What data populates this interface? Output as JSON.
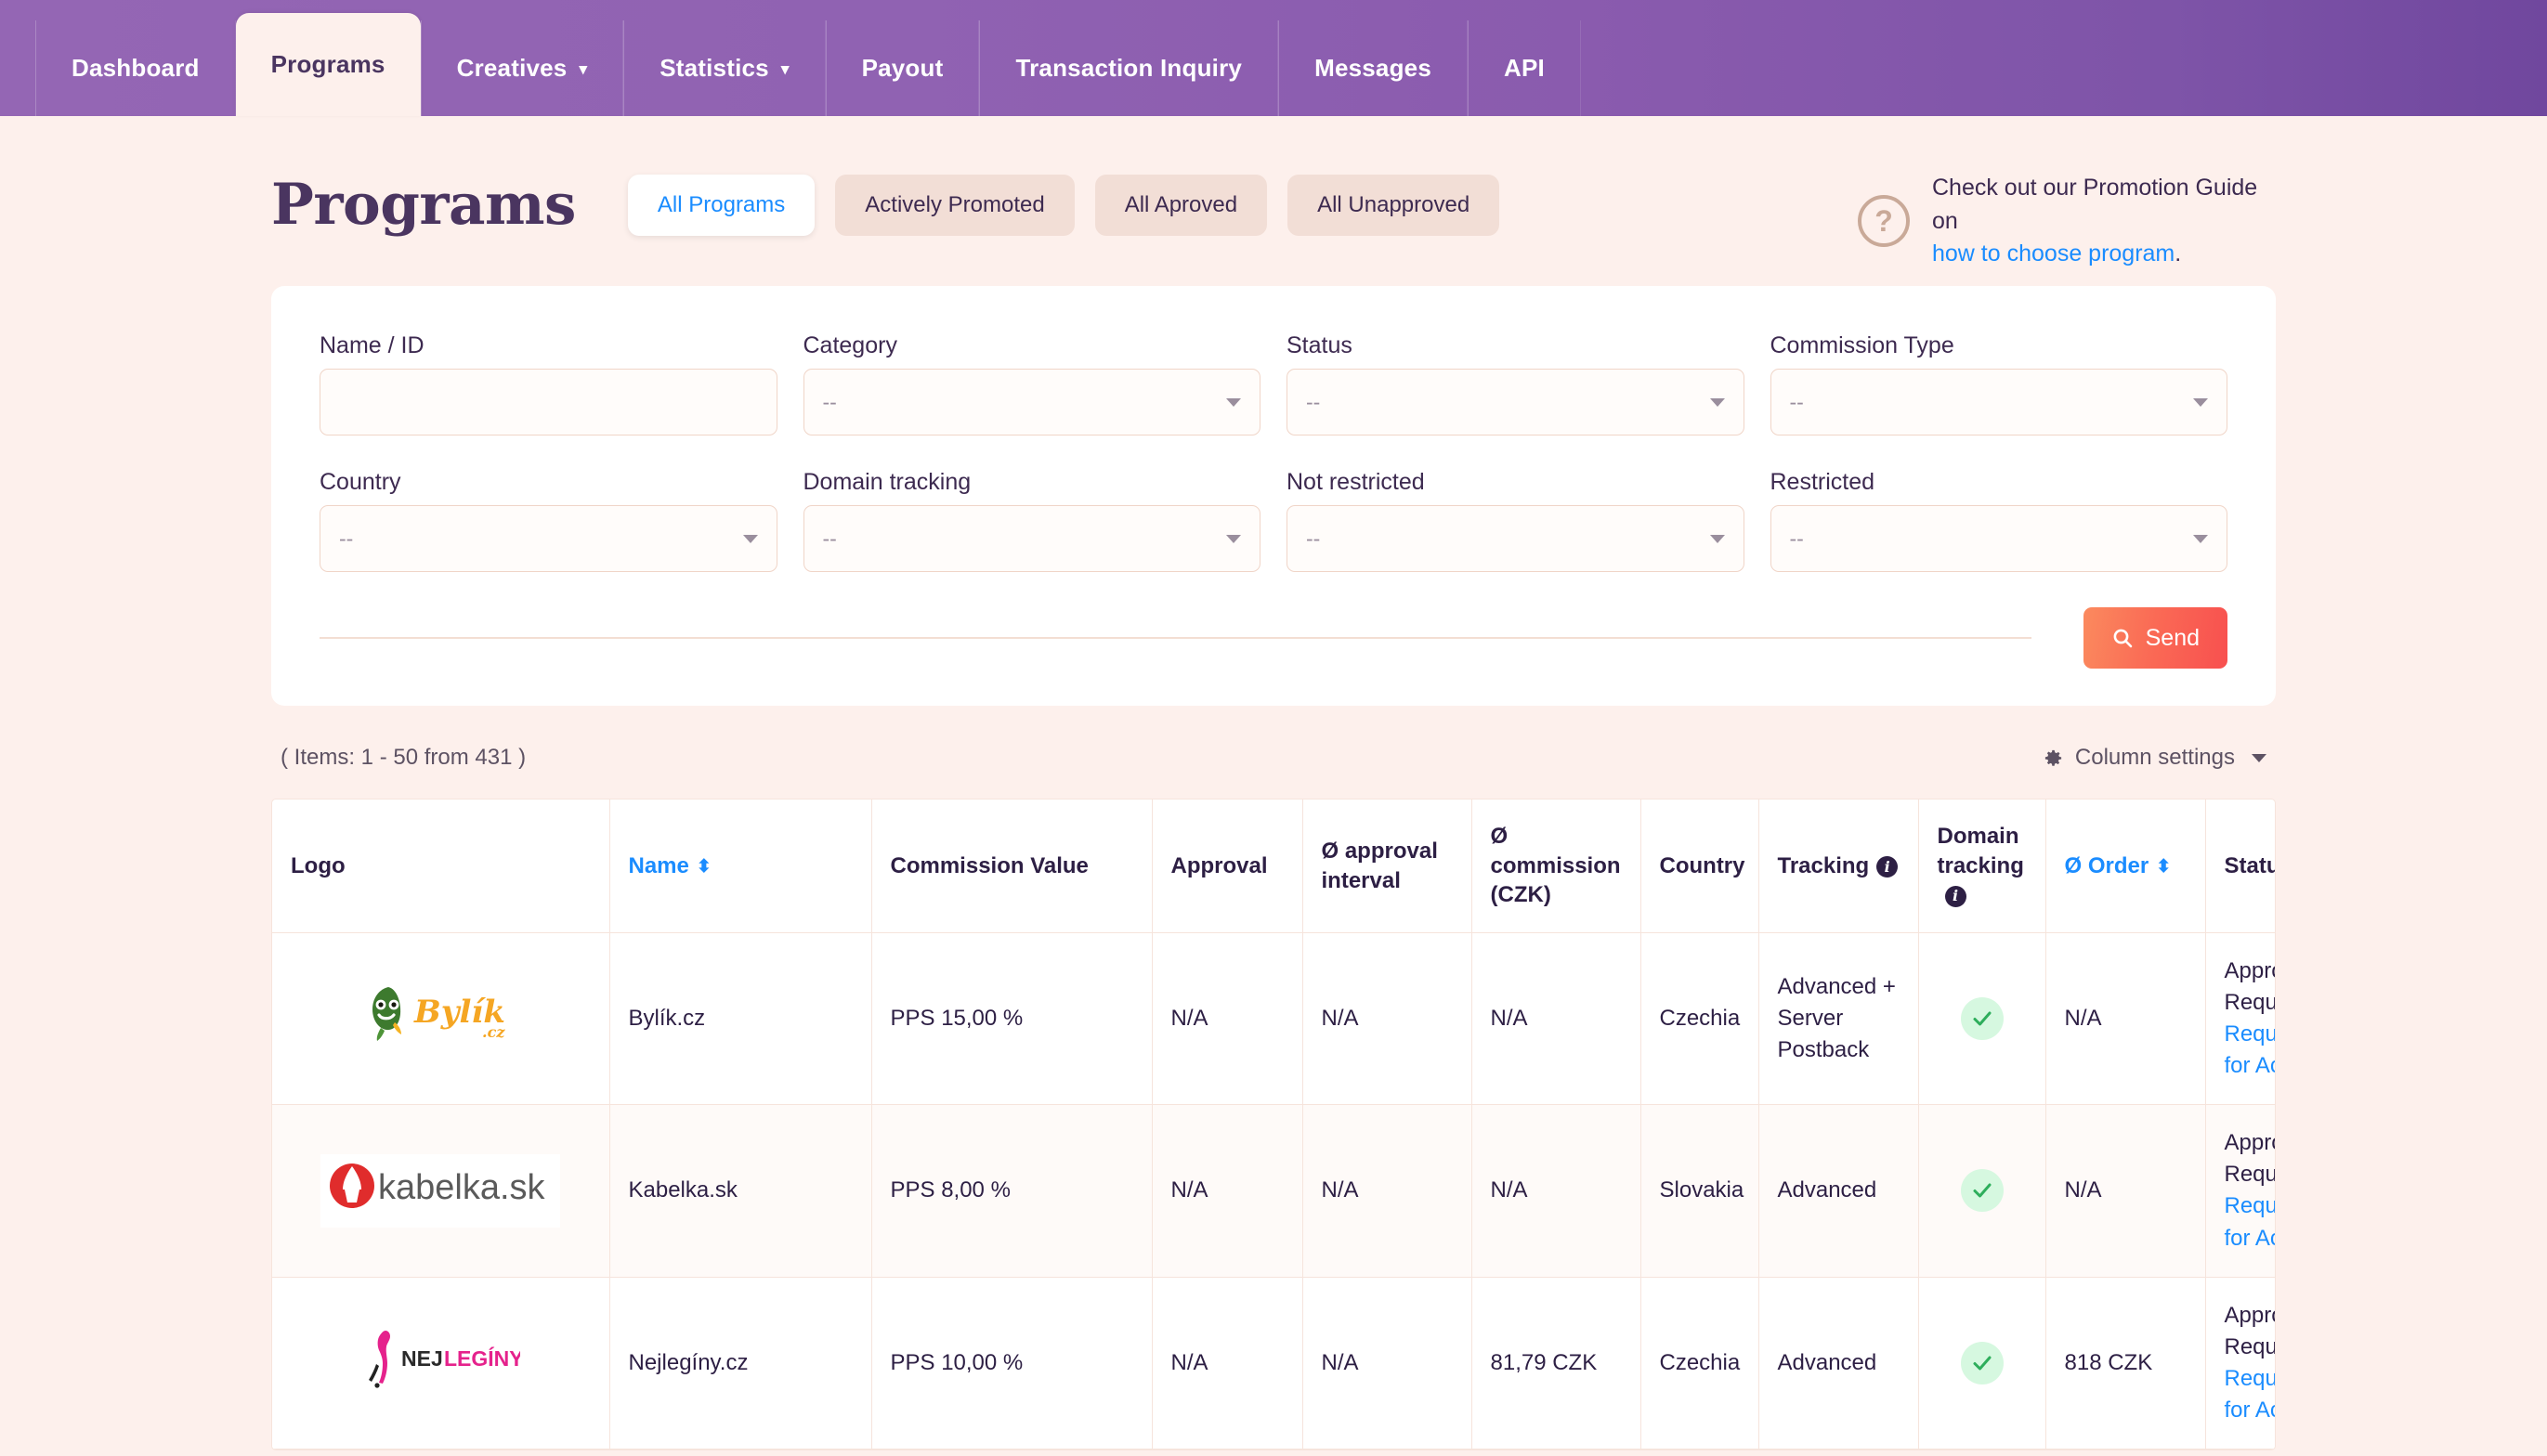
{
  "nav": {
    "items": [
      {
        "label": "Dashboard",
        "caret": false,
        "active": false
      },
      {
        "label": "Programs",
        "caret": false,
        "active": true
      },
      {
        "label": "Creatives",
        "caret": true,
        "active": false
      },
      {
        "label": "Statistics",
        "caret": true,
        "active": false
      },
      {
        "label": "Payout",
        "caret": false,
        "active": false
      },
      {
        "label": "Transaction Inquiry",
        "caret": false,
        "active": false
      },
      {
        "label": "Messages",
        "caret": false,
        "active": false
      },
      {
        "label": "API",
        "caret": false,
        "active": false
      }
    ],
    "caret_glyph": "▾"
  },
  "header": {
    "title": "Programs",
    "segments": [
      {
        "label": "All Programs",
        "active": true
      },
      {
        "label": "Actively Promoted",
        "active": false
      },
      {
        "label": "All Aproved",
        "active": false
      },
      {
        "label": "All Unapproved",
        "active": false
      }
    ],
    "promo": {
      "icon": "question-mark-circle-icon",
      "question_glyph": "?",
      "line1": "Check out our Promotion Guide on",
      "link": "how to choose program",
      "period": "."
    }
  },
  "filters": {
    "fields": [
      {
        "label": "Name / ID",
        "type": "text",
        "value": "",
        "placeholder": ""
      },
      {
        "label": "Category",
        "type": "select",
        "value": "--"
      },
      {
        "label": "Status",
        "type": "select",
        "value": "--"
      },
      {
        "label": "Commission Type",
        "type": "select",
        "value": "--"
      },
      {
        "label": "Country",
        "type": "select",
        "value": "--"
      },
      {
        "label": "Domain tracking",
        "type": "select",
        "value": "--"
      },
      {
        "label": "Not restricted",
        "type": "select",
        "value": "--"
      },
      {
        "label": "Restricted",
        "type": "select",
        "value": "--"
      }
    ],
    "send_label": "Send",
    "send_icon": "magnifier-icon"
  },
  "meta": {
    "items_count": "( Items: 1 - 50 from 431 )",
    "column_settings": "Column settings",
    "gear_icon": "gear-icon",
    "caret_icon": "chevron-down-icon"
  },
  "table": {
    "columns": [
      {
        "key": "logo",
        "label": "Logo",
        "sortable": false,
        "info": false
      },
      {
        "key": "name",
        "label": "Name",
        "sortable": true,
        "info": false
      },
      {
        "key": "commission",
        "label": "Commission Value",
        "sortable": false,
        "info": false
      },
      {
        "key": "approval",
        "label": "Approval",
        "sortable": false,
        "info": false
      },
      {
        "key": "interval",
        "label": "Ø approval interval",
        "sortable": false,
        "info": false
      },
      {
        "key": "avgcomm",
        "label": "Ø commission (CZK)",
        "sortable": false,
        "info": false
      },
      {
        "key": "country",
        "label": "Country",
        "sortable": false,
        "info": false
      },
      {
        "key": "tracking",
        "label": "Tracking",
        "sortable": false,
        "info": true
      },
      {
        "key": "domain",
        "label": "Domain tracking",
        "sortable": false,
        "info": true
      },
      {
        "key": "order",
        "label": "Ø Order",
        "sortable": true,
        "info": false
      },
      {
        "key": "status",
        "label": "Status",
        "sortable": false,
        "info": false
      }
    ],
    "sort_glyph": "⬍",
    "info_glyph": "i",
    "rows": [
      {
        "logo_alt": "Bylík.cz logo",
        "logo_type": "bylik",
        "name": "Bylík.cz",
        "commission": "PPS 15,00 %",
        "approval": "N/A",
        "interval": "N/A",
        "avgcomm": "N/A",
        "country": "Czechia",
        "tracking": "Advanced + Server Postback",
        "domain_tracking": "check",
        "order": "N/A",
        "status_text": "Approval Required",
        "status_link": "Request for Access"
      },
      {
        "logo_alt": "kabelka.sk logo",
        "logo_type": "kabelka",
        "name": "Kabelka.sk",
        "commission": "PPS 8,00 %",
        "approval": "N/A",
        "interval": "N/A",
        "avgcomm": "N/A",
        "country": "Slovakia",
        "tracking": "Advanced",
        "domain_tracking": "check",
        "order": "N/A",
        "status_text": "Approval Required",
        "status_link": "Request for Access"
      },
      {
        "logo_alt": "NEJLEGÍNY logo",
        "logo_type": "nejleginy",
        "name": "Nejlegíny.cz",
        "commission": "PPS 10,00 %",
        "approval": "N/A",
        "interval": "N/A",
        "avgcomm": "81,79 CZK",
        "country": "Czechia",
        "tracking": "Advanced",
        "domain_tracking": "check",
        "order": "818 CZK",
        "status_text": "Approval Required",
        "status_link": "Request for Access"
      }
    ]
  },
  "colors": {
    "page_bg": "#fdf0ec",
    "nav_purple": "#9062b2",
    "accent_link": "#1a8cff",
    "send_gradient_start": "#fb8a5e",
    "send_gradient_end": "#f8504f",
    "title_purple": "#4a3560",
    "check_green": "#2eae5c"
  }
}
